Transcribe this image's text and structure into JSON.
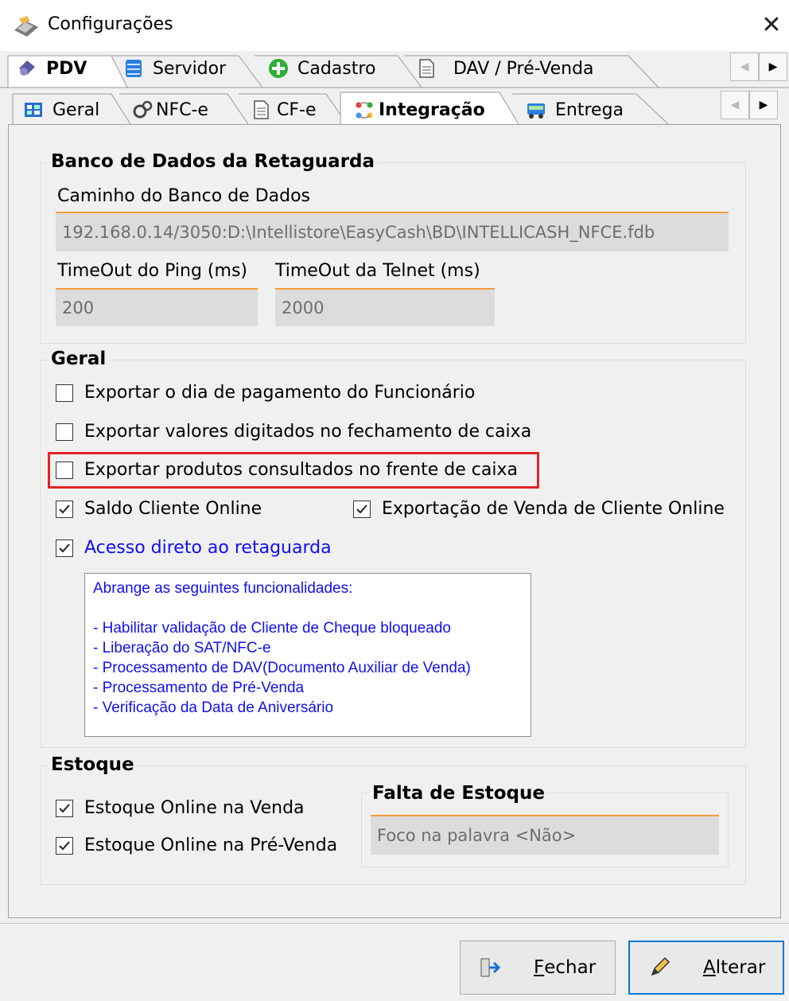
{
  "window": {
    "title": "Configurações",
    "close_glyph": "✕"
  },
  "tabs_top": [
    {
      "label": "PDV",
      "icon": "pdv-icon",
      "active": true
    },
    {
      "label": "Servidor",
      "icon": "server-icon"
    },
    {
      "label": "Cadastro",
      "icon": "add-green-icon"
    },
    {
      "label": "DAV / Pré-Venda",
      "icon": "document-icon"
    }
  ],
  "tabs_sub": [
    {
      "label": "Geral",
      "icon": "grid-icon"
    },
    {
      "label": "NFC-e",
      "icon": "gears-icon"
    },
    {
      "label": "CF-e",
      "icon": "document-icon"
    },
    {
      "label": "Integração",
      "icon": "integration-icon",
      "active": true
    },
    {
      "label": "Entrega",
      "icon": "delivery-icon"
    }
  ],
  "scroll": {
    "left": "◀",
    "right": "▶"
  },
  "banco": {
    "title": "Banco de Dados da Retaguarda",
    "caminho_label": "Caminho do Banco de Dados",
    "caminho_value": "192.168.0.14/3050:D:\\Intellistore\\EasyCash\\BD\\INTELLICASH_NFCE.fdb",
    "ping_label": "TimeOut do Ping (ms)",
    "ping_value": "200",
    "telnet_label": "TimeOut da Telnet (ms)",
    "telnet_value": "2000"
  },
  "geral": {
    "title": "Geral",
    "options": [
      {
        "label": "Exportar o dia de pagamento do Funcionário",
        "checked": false
      },
      {
        "label": "Exportar valores digitados no fechamento de caixa",
        "checked": false
      },
      {
        "label": "Exportar produtos consultados no frente de caixa",
        "checked": false
      },
      {
        "label": "Saldo Cliente Online",
        "checked": true
      },
      {
        "label": "Exportação de Venda de Cliente Online",
        "checked": true
      },
      {
        "label": "Acesso direto ao retaguarda",
        "checked": true
      }
    ],
    "info_lines": [
      "Abrange as seguintes funcionalidades:",
      "",
      "- Habilitar validação de Cliente de Cheque bloqueado",
      "- Liberação do SAT/NFC-e",
      "- Processamento de DAV(Documento Auxiliar de Venda)",
      "- Processamento de Pré-Venda",
      "- Verificação da Data de Aniversário"
    ]
  },
  "estoque": {
    "title": "Estoque",
    "options": [
      {
        "label": "Estoque Online na Venda",
        "checked": true
      },
      {
        "label": "Estoque Online na Pré-Venda",
        "checked": true
      }
    ],
    "falta_title": "Falta de Estoque",
    "falta_value": "Foco na palavra <Não>"
  },
  "buttons": {
    "fechar_first": "F",
    "fechar_rest": "echar",
    "alterar_first": "A",
    "alterar_rest": "lterar"
  },
  "colors": {
    "accent": "#f39c3a",
    "highlight": "#e32226",
    "link": "#1010ee",
    "focus": "#0078d7"
  }
}
